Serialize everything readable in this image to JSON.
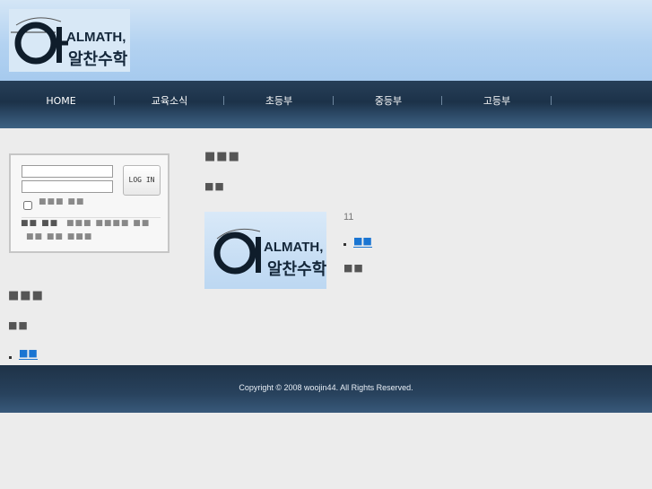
{
  "logo": {
    "text": "ALMATH,",
    "subtext": "알찬수학"
  },
  "nav": {
    "items": [
      "HOME",
      "교육소식",
      "초등부",
      "중등부",
      "고등부"
    ]
  },
  "login": {
    "button_label": "LOG IN",
    "remember_label": "■■■ ■■",
    "links_primary": "■■ ■■",
    "links_secondary": "■■■ ■■■■ ■■",
    "links_tertiary": "■■ ■■ ■■■"
  },
  "left": {
    "heading": "■■■",
    "subheading": "■■",
    "link": "■■"
  },
  "main": {
    "heading": "■■■",
    "subheading": "■■",
    "count": "11",
    "link": "■■",
    "caption": "■■"
  },
  "thumb": {
    "text": "ALMATH,",
    "subtext": "알찬수학"
  },
  "footer": {
    "copyright": "Copyright © 2008 woojin44. All Rights Reserved."
  },
  "colors": {
    "nav_bg": "#1c3249",
    "link_blue": "#1a75d2",
    "header_sky": "#b3d2f1"
  }
}
